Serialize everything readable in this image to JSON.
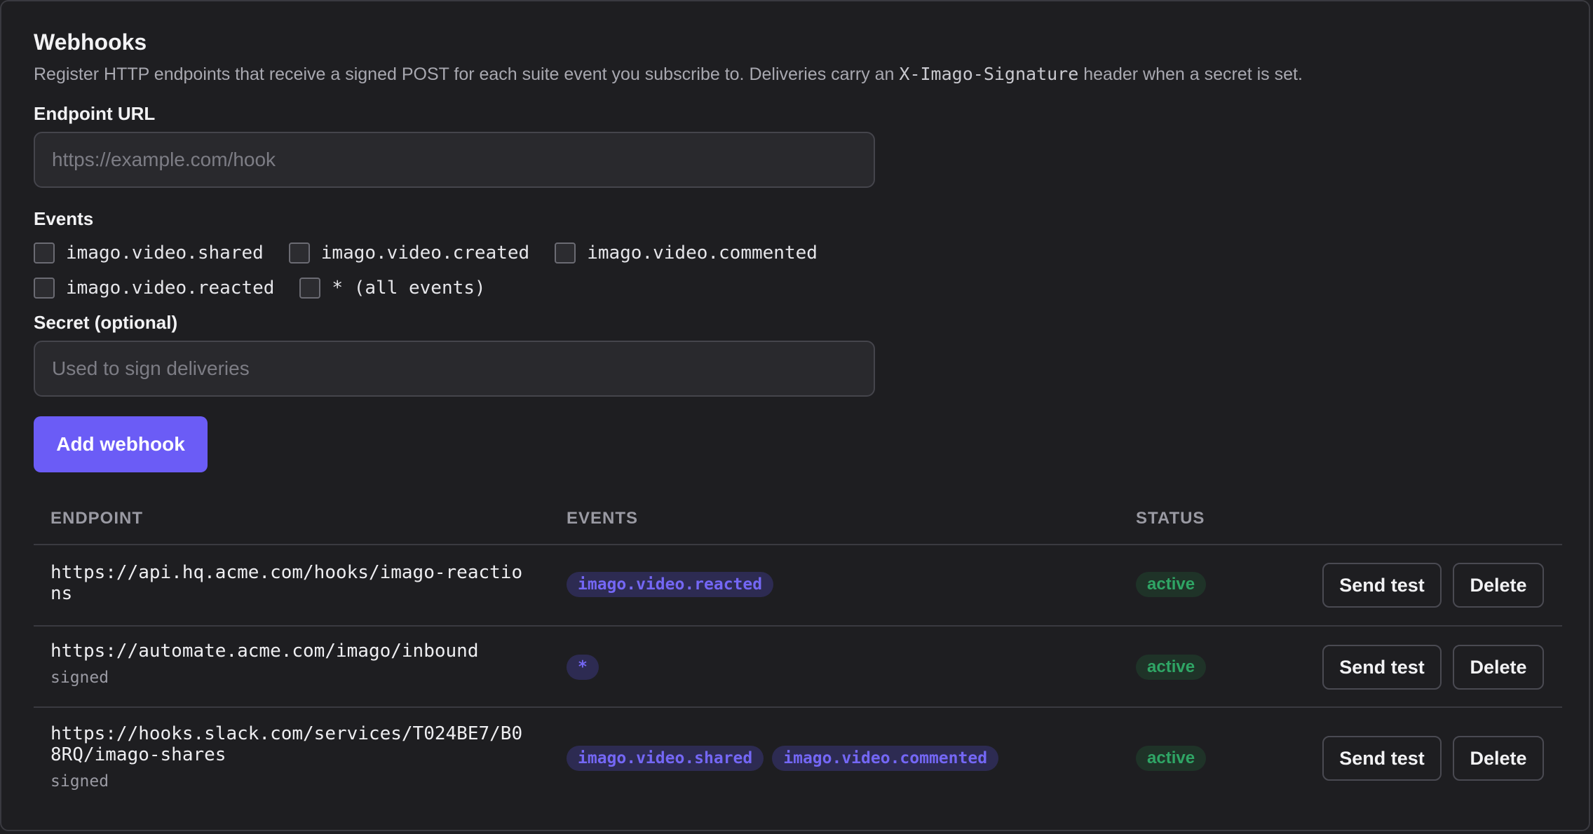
{
  "webhooks": {
    "title": "Webhooks",
    "description_before": "Register HTTP endpoints that receive a signed POST for each suite event you subscribe to. Deliveries carry an ",
    "description_code": "X-Imago-Signature",
    "description_after": " header when a secret is set."
  },
  "form": {
    "endpoint_label": "Endpoint URL",
    "endpoint_placeholder": "https://example.com/hook",
    "events_label": "Events",
    "event_options": [
      {
        "label": "imago.video.shared",
        "checked": false
      },
      {
        "label": "imago.video.created",
        "checked": false
      },
      {
        "label": "imago.video.commented",
        "checked": false
      },
      {
        "label": "imago.video.reacted",
        "checked": false
      },
      {
        "label": "* (all events)",
        "checked": false
      }
    ],
    "secret_label": "Secret (optional)",
    "secret_placeholder": "Used to sign deliveries",
    "add_button": "Add webhook"
  },
  "table": {
    "headers": {
      "endpoint": "ENDPOINT",
      "events": "EVENTS",
      "status": "STATUS"
    },
    "rows": [
      {
        "endpoint": "https://api.hq.acme.com/hooks/imago-reactions",
        "signed": "",
        "events": [
          "imago.video.reacted"
        ],
        "status": "active",
        "send_test": "Send test",
        "delete": "Delete"
      },
      {
        "endpoint": "https://automate.acme.com/imago/inbound",
        "signed": "signed",
        "events": [
          "*"
        ],
        "status": "active",
        "send_test": "Send test",
        "delete": "Delete"
      },
      {
        "endpoint": "https://hooks.slack.com/services/T024BE7/B08RQ/imago-shares",
        "signed": "signed",
        "events": [
          "imago.video.shared",
          "imago.video.commented"
        ],
        "status": "active",
        "send_test": "Send test",
        "delete": "Delete"
      }
    ]
  },
  "colors": {
    "accent": "#6b5cf6",
    "status_active": "#2fa565",
    "chip_text": "#7467f5",
    "background": "#1e1e21"
  }
}
